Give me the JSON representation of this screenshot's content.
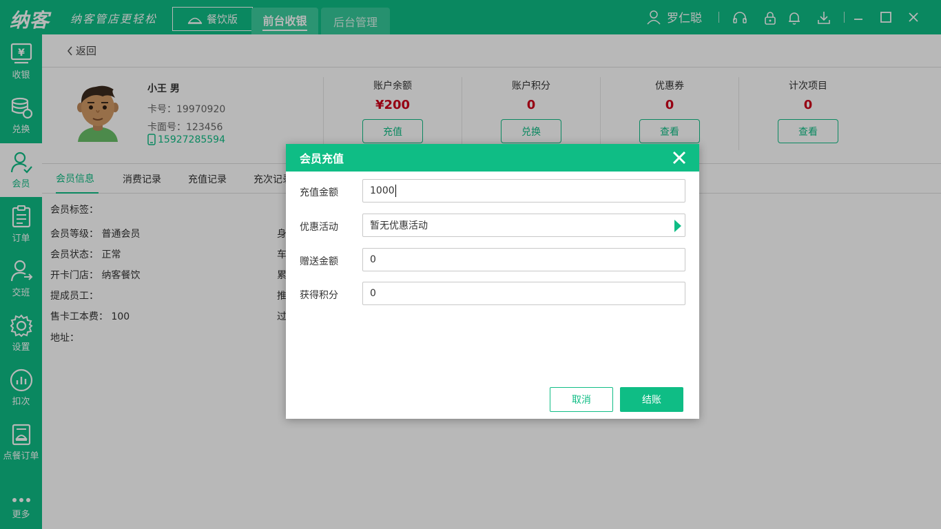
{
  "app": {
    "logo": "纳客",
    "slogan": "纳客管店更轻松",
    "edition": "餐饮版",
    "nav_tabs": [
      "前台收银",
      "后台管理"
    ],
    "user_name": "罗仁聪"
  },
  "sidebar": {
    "items": [
      {
        "label": "收银",
        "icon": "cashier-icon"
      },
      {
        "label": "兑换",
        "icon": "coins-icon"
      },
      {
        "label": "会员",
        "icon": "member-icon"
      },
      {
        "label": "订单",
        "icon": "order-icon"
      },
      {
        "label": "交班",
        "icon": "shift-icon"
      },
      {
        "label": "设置",
        "icon": "gear-icon"
      },
      {
        "label": "扣次",
        "icon": "chart-icon"
      },
      {
        "label": "点餐订单",
        "icon": "dish-order-icon"
      },
      {
        "label": "更多",
        "icon": "more-icon"
      }
    ],
    "active": "会员"
  },
  "page": {
    "back_label": "返回"
  },
  "profile": {
    "name": "小王 男",
    "card_no": "卡号：19970920",
    "face_no": "卡面号：123456",
    "phone": "15927285594"
  },
  "stats": [
    {
      "label": "账户余额",
      "value": "¥200",
      "button": "充值"
    },
    {
      "label": "账户积分",
      "value": "0",
      "button": "兑换"
    },
    {
      "label": "优惠券",
      "value": "0",
      "button": "查看"
    },
    {
      "label": "计次项目",
      "value": "0",
      "button": "查看"
    }
  ],
  "tabs": [
    "会员信息",
    "消费记录",
    "充值记录",
    "充次记录"
  ],
  "info_left": [
    "会员标签：",
    "会员等级：  普通会员",
    "会员状态：  正常",
    "开卡门店：  纳客餐饮",
    "提成员工：",
    "售卡工本费：  100",
    "地址："
  ],
  "info_right_partial": [
    "身",
    "车",
    "累",
    "推",
    "过"
  ],
  "dialog": {
    "title": "会员充值",
    "fields": [
      {
        "label": "充值金额",
        "value": "1000"
      },
      {
        "label": "优惠活动",
        "value": "暂无优惠活动"
      },
      {
        "label": "赠送金额",
        "value": "0"
      },
      {
        "label": "获得积分",
        "value": "0"
      }
    ],
    "cancel_label": "取消",
    "confirm_label": "结账"
  },
  "colors": {
    "brand": "#0fbd85",
    "price": "#d0021b"
  }
}
